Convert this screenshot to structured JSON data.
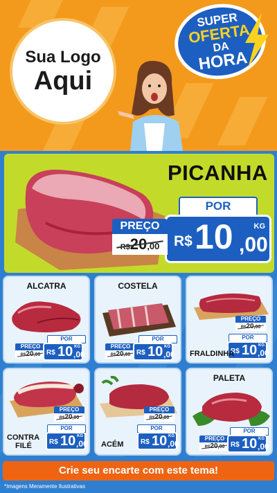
{
  "header": {
    "logo_line1": "Sua Logo",
    "logo_line2": "Aqui",
    "badge": {
      "line1": "SUPER",
      "line2": "OFERTA",
      "line3": "DA",
      "line4": "HORA"
    }
  },
  "hero": {
    "title": "PICANHA",
    "por_label": "POR",
    "old_label": "PREÇO",
    "old_currency": "R$",
    "old_int": "20",
    "old_dec": ",00",
    "currency": "R$",
    "price_int": "10",
    "price_dec": ",00",
    "unit": "KG"
  },
  "cards": [
    {
      "name": "ALCATRA",
      "preco_label": "PREÇO",
      "old_c": "R$",
      "old_n": "20",
      "old_d": ",00",
      "por_label": "POR",
      "cur": "R$",
      "int": "10",
      "dec": ",00",
      "unit": "KG"
    },
    {
      "name": "COSTELA",
      "preco_label": "PREÇO",
      "old_c": "R$",
      "old_n": "20",
      "old_d": ",00",
      "por_label": "POR",
      "cur": "R$",
      "int": "10",
      "dec": ",00",
      "unit": "KG"
    },
    {
      "name": "FRALDINHA",
      "preco_label": "PREÇO",
      "old_c": "R$",
      "old_n": "20",
      "old_d": ",00",
      "por_label": "POR",
      "cur": "R$",
      "int": "10",
      "dec": ",00",
      "unit": "KG"
    },
    {
      "name_line1": "CONTRA",
      "name_line2": "FILÉ",
      "preco_label": "PREÇO",
      "old_c": "R$",
      "old_n": "20",
      "old_d": ",00",
      "por_label": "POR",
      "cur": "R$",
      "int": "10",
      "dec": ",00",
      "unit": "KG"
    },
    {
      "name": "ACÉM",
      "preco_label": "PREÇO",
      "old_c": "R$",
      "old_n": "20",
      "old_d": ",00",
      "por_label": "POR",
      "cur": "R$",
      "int": "10",
      "dec": ",00",
      "unit": "KG"
    },
    {
      "name": "PALETA",
      "preco_label": "PREÇO",
      "old_c": "R$",
      "old_n": "20",
      "old_d": ",00",
      "por_label": "POR",
      "cur": "R$",
      "int": "10",
      "dec": ",00",
      "unit": "KG"
    }
  ],
  "cta": "Crie seu encarte com este tema!",
  "disclaimer": "*Imagens Meramente Ilustrativas",
  "colors": {
    "orange": "#f39a1c",
    "blue": "#1d5fc0",
    "lime": "#c2db2a",
    "cta": "#ef6413"
  }
}
